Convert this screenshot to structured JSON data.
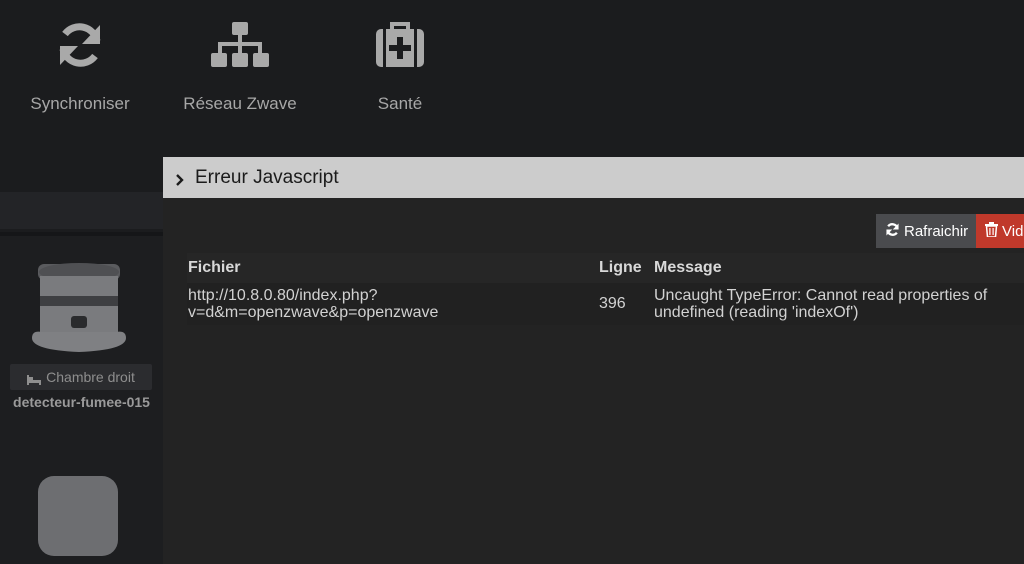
{
  "tiles": {
    "sync": {
      "label": "Synchroniser",
      "icon": "sync-icon"
    },
    "zwave": {
      "label": "Réseau Zwave",
      "icon": "network-icon"
    },
    "health": {
      "label": "Santé",
      "icon": "medkit-icon"
    }
  },
  "equipment": {
    "room": "Chambre droit",
    "name": "detecteur-fumee-015",
    "room_icon": "bed-icon"
  },
  "error_panel": {
    "title": "Erreur Javascript",
    "refresh_label": "Rafraichir",
    "clear_label": "Vid",
    "columns": {
      "file": "Fichier",
      "line": "Ligne",
      "message": "Message"
    },
    "rows": [
      {
        "file": "http://10.8.0.80/index.php?v=d&m=openzwave&p=openzwave",
        "line": "396",
        "message": "Uncaught TypeError: Cannot read properties of undefined (reading 'indexOf')"
      }
    ]
  },
  "colors": {
    "background": "#1b1c1e",
    "panel": "#232323",
    "header": "#cccccc",
    "danger": "#c0392b",
    "icon": "#a9a9a9"
  }
}
